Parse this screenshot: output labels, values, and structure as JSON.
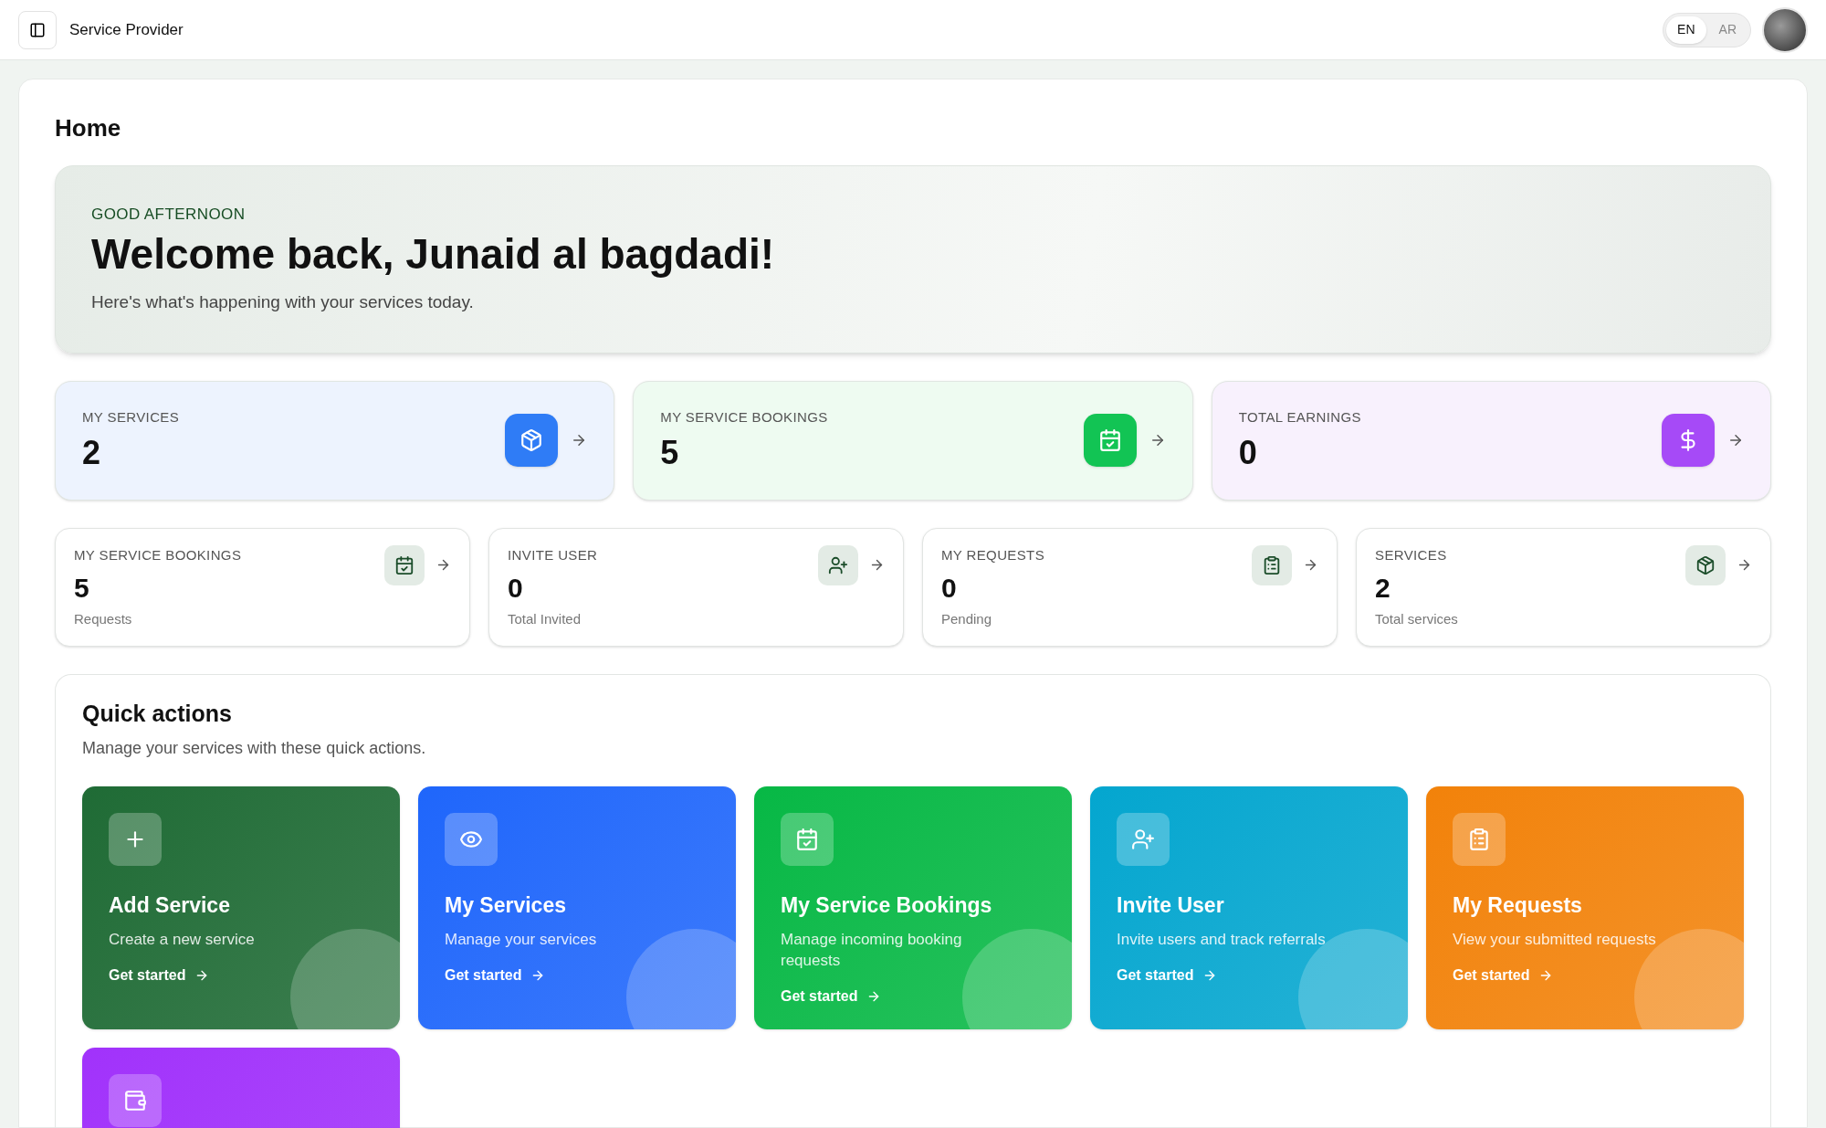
{
  "header": {
    "title": "Service Provider",
    "languages": [
      {
        "label": "EN",
        "selected": true
      },
      {
        "label": "AR",
        "selected": false
      }
    ]
  },
  "page_title": "Home",
  "hero": {
    "greeting": "GOOD AFTERNOON",
    "heading": "Welcome back, Junaid al bagdadi!",
    "subtitle": "Here's what's happening with your services today."
  },
  "summary_cards": [
    {
      "label": "MY SERVICES",
      "value": "2",
      "color": "#2f7cf6"
    },
    {
      "label": "MY SERVICE BOOKINGS",
      "value": "5",
      "color": "#12c454"
    },
    {
      "label": "TOTAL EARNINGS",
      "value": "0",
      "color": "#a64af7"
    }
  ],
  "stat_cards": [
    {
      "label": "MY SERVICE BOOKINGS",
      "value": "5",
      "caption": "Requests"
    },
    {
      "label": "INVITE USER",
      "value": "0",
      "caption": "Total Invited"
    },
    {
      "label": "MY REQUESTS",
      "value": "0",
      "caption": "Pending"
    },
    {
      "label": "SERVICES",
      "value": "2",
      "caption": "Total services"
    }
  ],
  "quick_actions": {
    "title": "Quick actions",
    "subtitle": "Manage your services with these quick actions.",
    "items": [
      {
        "title": "Add Service",
        "description": "Create a new service",
        "link": "Get started",
        "color": "#1f6b35"
      },
      {
        "title": "My Services",
        "description": "Manage your services",
        "link": "Get started",
        "color": "#1f66fb"
      },
      {
        "title": "My Service Bookings",
        "description": "Manage incoming booking requests",
        "link": "Get started",
        "color": "#07b845"
      },
      {
        "title": "Invite User",
        "description": "Invite users and track referrals",
        "link": "Get started",
        "color": "#04a6cf"
      },
      {
        "title": "My Requests",
        "description": "View your submitted requests",
        "link": "Get started",
        "color": "#f2820a"
      },
      {
        "color": "#a132fb"
      }
    ]
  }
}
